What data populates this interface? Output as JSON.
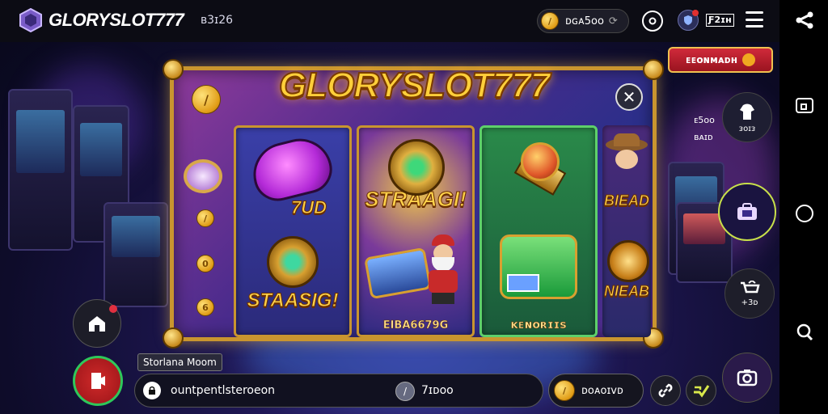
{
  "header": {
    "brand": "GLORYSLOT777",
    "code": "ʙ3ɪ26",
    "balance": "ᴅɢᴀ5ᴏᴏ",
    "mini_badge": "Ƒ2ɪʜ"
  },
  "promo_button": {
    "label": "ᴇᴇᴏɴᴍᴀᴅʜ"
  },
  "modal": {
    "title": "GLORYSLOT777",
    "close_label": "✕",
    "reels": [
      {
        "tiles": [
          {
            "label": "7UD"
          },
          {
            "label": "STAASIG!"
          }
        ],
        "caption": ""
      },
      {
        "tiles": [
          {
            "label": "STRAAGI!"
          },
          {
            "label": ""
          }
        ],
        "caption": "EIBA6679G"
      },
      {
        "tiles": [
          {
            "label": ""
          },
          {
            "label": ""
          }
        ],
        "caption": "ᴋᴇɴᴏʀɪɪs"
      },
      {
        "tiles": [
          {
            "label": "BIEAD"
          },
          {
            "label": "NIEAB"
          }
        ],
        "caption": ""
      }
    ]
  },
  "side_panel": {
    "stat_value": "ᴇ5ᴏᴏ",
    "stat_label": "ʙᴀɪᴅ",
    "shop_label": "ᴈᴏɪᴈ",
    "cart_count": "+3ᴅ"
  },
  "tooltip": {
    "text": "Storlana Moom"
  },
  "bottom_bar": {
    "input_text": "ountpentlsteroeon",
    "mid_value": "7ɪᴅᴏᴏ",
    "coin_value": "ᴅᴏᴀᴏɪᴠᴅ"
  },
  "colors": {
    "accent_gold": "#c9952f",
    "promo_red": "#b81c2a",
    "active_ring": "#c8e04a"
  }
}
